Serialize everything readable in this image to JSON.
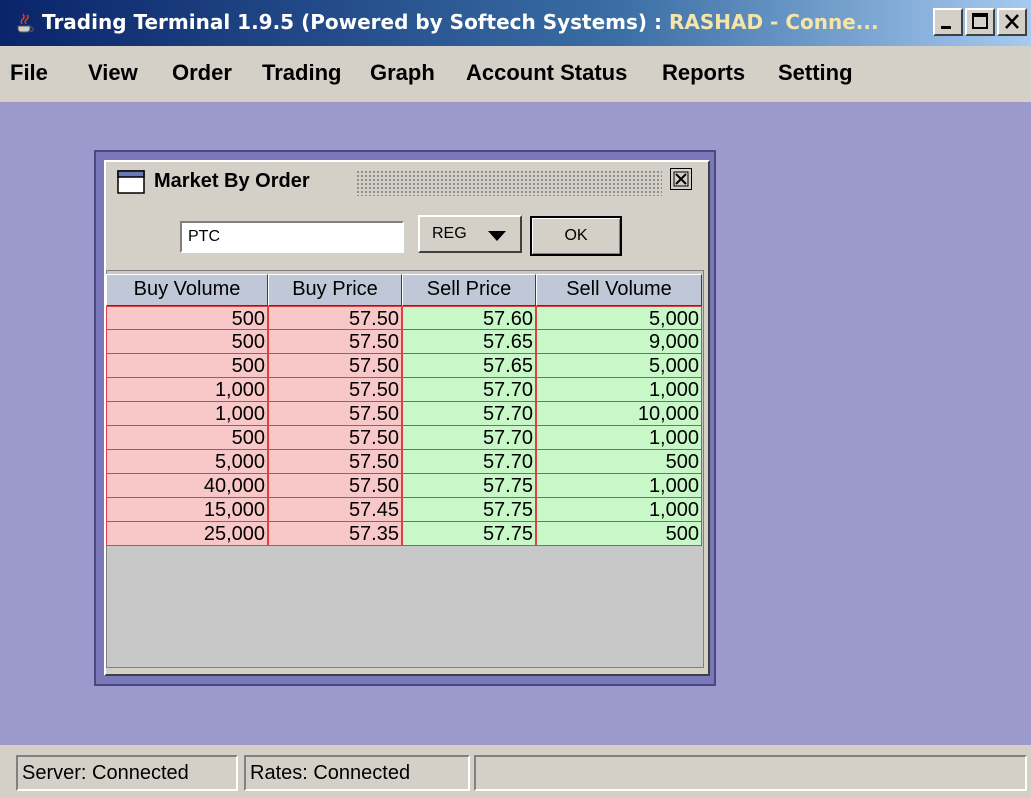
{
  "window": {
    "title": "Trading Terminal 1.9.5 (Powered by Softech Systems)  :  ",
    "title_conn": "RASHAD - Conne...",
    "accent": "#0a246a"
  },
  "menu": [
    {
      "label": "File"
    },
    {
      "label": "View"
    },
    {
      "label": "Order"
    },
    {
      "label": "Trading"
    },
    {
      "label": "Graph"
    },
    {
      "label": "Account Status"
    },
    {
      "label": "Reports"
    },
    {
      "label": "Setting"
    }
  ],
  "frame": {
    "title": "Market By Order",
    "symbol_value": "PTC",
    "market_selected": "REG",
    "ok_label": "OK"
  },
  "table": {
    "headers": [
      "Buy Volume",
      "Buy Price",
      "Sell Price",
      "Sell Volume"
    ],
    "rows": [
      [
        "500",
        "57.50",
        "57.60",
        "5,000"
      ],
      [
        "500",
        "57.50",
        "57.65",
        "9,000"
      ],
      [
        "500",
        "57.50",
        "57.65",
        "5,000"
      ],
      [
        "1,000",
        "57.50",
        "57.70",
        "1,000"
      ],
      [
        "1,000",
        "57.50",
        "57.70",
        "10,000"
      ],
      [
        "500",
        "57.50",
        "57.70",
        "1,000"
      ],
      [
        "5,000",
        "57.50",
        "57.70",
        "500"
      ],
      [
        "40,000",
        "57.50",
        "57.75",
        "1,000"
      ],
      [
        "15,000",
        "57.45",
        "57.75",
        "1,000"
      ],
      [
        "25,000",
        "57.35",
        "57.75",
        "500"
      ]
    ],
    "buy_color": "#f8c8c8",
    "sell_color": "#c8f8c8"
  },
  "status": {
    "server": "Server: Connected",
    "rates": "Rates: Connected",
    "extra": ""
  },
  "icons": {
    "app": "java-cup-icon",
    "frame": "window-icon",
    "close": "close-icon"
  }
}
